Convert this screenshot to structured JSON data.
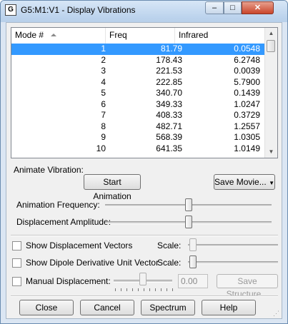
{
  "window": {
    "title": "G5:M1:V1 - Display Vibrations",
    "app_icon": "document-icon"
  },
  "list": {
    "columns": [
      "Mode #",
      "Freq",
      "Infrared"
    ],
    "selected_index": 0,
    "rows": [
      {
        "mode": "1",
        "freq": "81.79",
        "ir": "0.0548"
      },
      {
        "mode": "2",
        "freq": "178.43",
        "ir": "6.2748"
      },
      {
        "mode": "3",
        "freq": "221.53",
        "ir": "0.0039"
      },
      {
        "mode": "4",
        "freq": "222.85",
        "ir": "5.7900"
      },
      {
        "mode": "5",
        "freq": "340.70",
        "ir": "0.1439"
      },
      {
        "mode": "6",
        "freq": "349.33",
        "ir": "1.0247"
      },
      {
        "mode": "7",
        "freq": "408.33",
        "ir": "0.3729"
      },
      {
        "mode": "8",
        "freq": "482.71",
        "ir": "1.2557"
      },
      {
        "mode": "9",
        "freq": "568.39",
        "ir": "1.0305"
      },
      {
        "mode": "10",
        "freq": "641.35",
        "ir": "1.0149"
      }
    ]
  },
  "animate": {
    "group_label": "Animate Vibration:",
    "start_label": "Start Animation",
    "save_movie_label": "Save Movie...",
    "frequency_label": "Animation Frequency:",
    "frequency_level": 0.5,
    "amplitude_label": "Displacement Amplitude:",
    "amplitude_level": 0.5
  },
  "options": {
    "show_vectors_label": "Show Displacement Vectors",
    "show_vectors_checked": false,
    "show_dipole_label": "Show Dipole Derivative Unit Vector",
    "show_dipole_checked": false,
    "scale_label": "Scale:",
    "manual_label": "Manual Displacement:",
    "manual_checked": false,
    "manual_value": "0.00",
    "save_structure_label": "Save Structure..."
  },
  "buttons": {
    "close": "Close",
    "cancel": "Cancel",
    "spectrum": "Spectrum",
    "help": "Help"
  }
}
